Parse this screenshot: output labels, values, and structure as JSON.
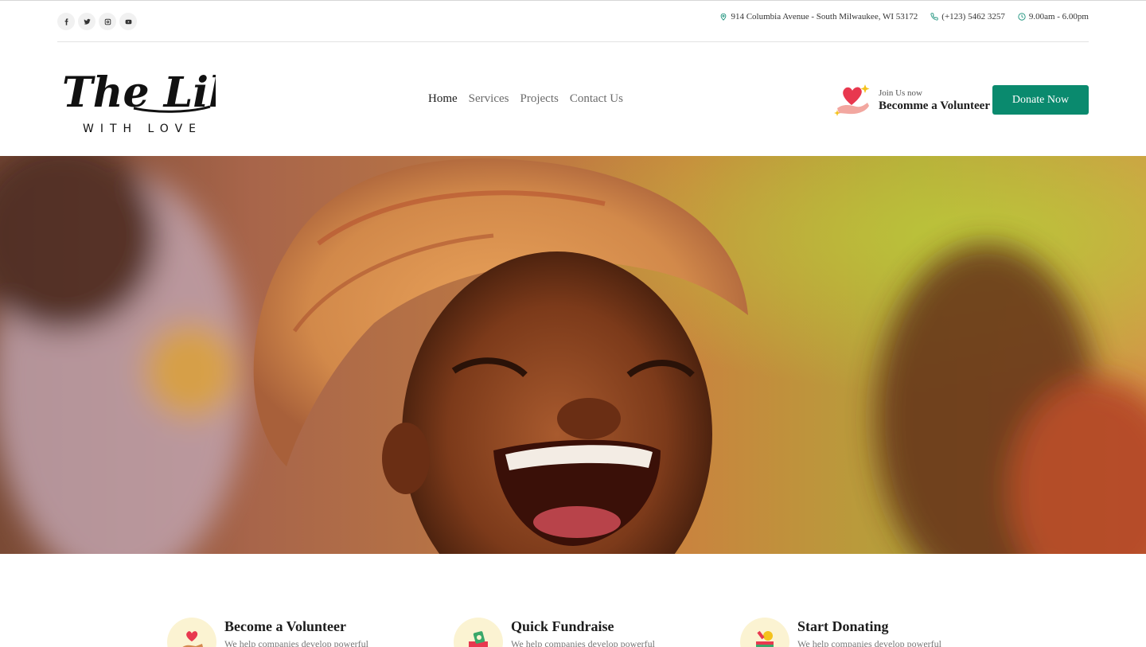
{
  "topbar": {
    "socials": [
      {
        "icon": "facebook-icon",
        "name": "facebook"
      },
      {
        "icon": "twitter-icon",
        "name": "twitter"
      },
      {
        "icon": "instagram-icon",
        "name": "instagram"
      },
      {
        "icon": "youtube-icon",
        "name": "youtube"
      }
    ],
    "address": "914 Columbia Avenue - South Milwaukee, WI 53172",
    "phone": "(+123) 5462 3257",
    "hours": "9.00am - 6.00pm"
  },
  "logo": {
    "line1": "The Lilos",
    "line2": "WITH LOVE"
  },
  "nav": {
    "items": [
      "Home",
      "Services",
      "Projects",
      "Contact Us"
    ],
    "active": "Home"
  },
  "volunteer": {
    "small": "Join Us now",
    "big": "Becomme a Volunteer"
  },
  "donate_button": "Donate Now",
  "features": [
    {
      "title": "Become a Volunteer",
      "desc": "We help companies develop powerful",
      "icon": "heart-hand-icon"
    },
    {
      "title": "Quick Fundraise",
      "desc": "We help companies develop powerful",
      "icon": "money-box-icon"
    },
    {
      "title": "Start Donating",
      "desc": "We help companies develop powerful",
      "icon": "donation-box-icon"
    }
  ],
  "colors": {
    "accent": "#0a8a6e",
    "feature_icon_bg": "#fbf3d2"
  }
}
